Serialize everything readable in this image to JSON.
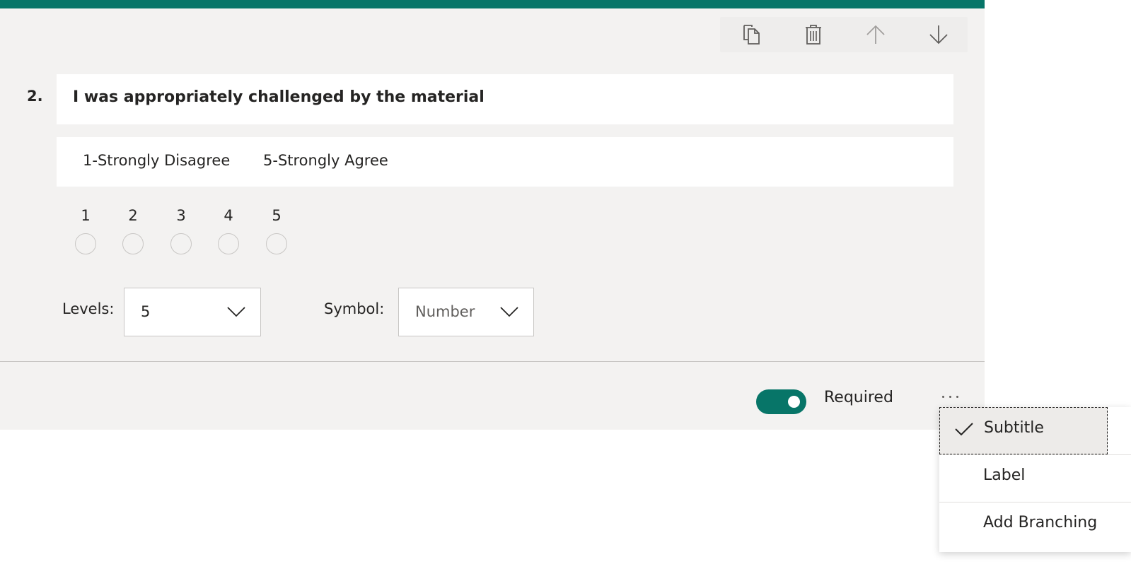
{
  "question": {
    "number": "2.",
    "title": "I was appropriately challenged by the material",
    "subtitle_left": "1-Strongly Disagree",
    "subtitle_right": "5-Strongly Agree",
    "rating_options": [
      "1",
      "2",
      "3",
      "4",
      "5"
    ]
  },
  "settings": {
    "levels_label": "Levels:",
    "levels_value": "5",
    "symbol_label": "Symbol:",
    "symbol_value": "Number"
  },
  "footer": {
    "required_label": "Required",
    "required_on": true
  },
  "menu": {
    "items": [
      {
        "label": "Subtitle",
        "checked": true
      },
      {
        "label": "Label",
        "checked": false
      },
      {
        "label": "Add Branching",
        "checked": false
      }
    ]
  },
  "toolbar": {
    "icons": [
      "copy-icon",
      "delete-icon",
      "move-up-icon",
      "move-down-icon"
    ]
  },
  "colors": {
    "accent": "#077568",
    "card_background": "#f3f2f1"
  }
}
